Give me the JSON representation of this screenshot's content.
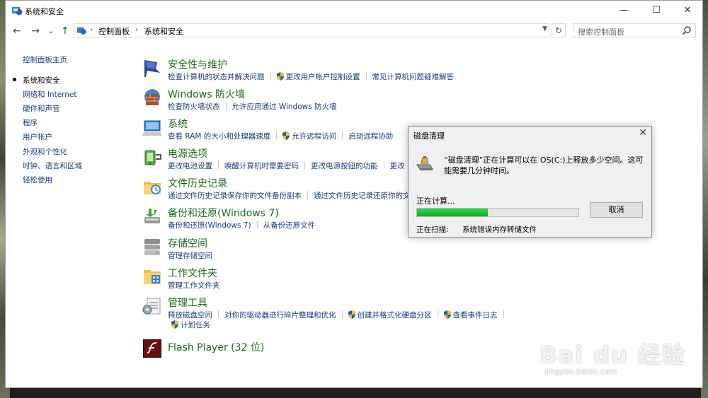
{
  "window": {
    "title": "系统和安全",
    "minimize": "—",
    "maximize": "☐",
    "close": "✕"
  },
  "nav": {
    "back": "←",
    "forward": "→",
    "recent": "⌄",
    "up": "↑",
    "breadcrumb": [
      "控制面板",
      "系统和安全"
    ],
    "refresh": "↻",
    "search_placeholder": "搜索控制面板"
  },
  "sidebar": {
    "items": [
      {
        "label": "控制面板主页"
      },
      {
        "label": "系统和安全"
      },
      {
        "label": "网络和 Internet"
      },
      {
        "label": "硬件和声音"
      },
      {
        "label": "程序"
      },
      {
        "label": "用户帐户"
      },
      {
        "label": "外观和个性化"
      },
      {
        "label": "时钟、语言和区域"
      },
      {
        "label": "轻松使用"
      }
    ]
  },
  "categories": [
    {
      "title": "安全性与维护",
      "icon": "flag-icon",
      "links": [
        {
          "label": "检查计算机的状态并解决问题",
          "shield": false
        },
        {
          "label": "更改用户帐户控制设置",
          "shield": true
        },
        {
          "label": "常见计算机问题疑难解答",
          "shield": false
        }
      ]
    },
    {
      "title": "Windows 防火墙",
      "icon": "firewall-icon",
      "links": [
        {
          "label": "检查防火墙状态",
          "shield": false
        },
        {
          "label": "允许应用通过 Windows 防火墙",
          "shield": false
        }
      ]
    },
    {
      "title": "系统",
      "icon": "computer-icon",
      "links": [
        {
          "label": "查看 RAM 的大小和处理器速度",
          "shield": false
        },
        {
          "label": "允许远程访问",
          "shield": true
        },
        {
          "label": "启动远程协助",
          "shield": false
        }
      ]
    },
    {
      "title": "电源选项",
      "icon": "power-icon",
      "links": [
        {
          "label": "更改电池设置",
          "shield": false
        },
        {
          "label": "唤醒计算机时需要密码",
          "shield": false
        },
        {
          "label": "更改电源按钮的功能",
          "shield": false
        },
        {
          "label": "更改",
          "shield": false
        }
      ]
    },
    {
      "title": "文件历史记录",
      "icon": "file-history-icon",
      "links": [
        {
          "label": "通过文件历史记录保存你的文件备份副本",
          "shield": false
        },
        {
          "label": "通过文件历史记录还原你的文",
          "shield": false
        }
      ]
    },
    {
      "title": "备份和还原(Windows 7)",
      "icon": "backup-icon",
      "links": [
        {
          "label": "备份和还原(Windows 7)",
          "shield": false
        },
        {
          "label": "从备份还原文件",
          "shield": false
        }
      ]
    },
    {
      "title": "存储空间",
      "icon": "storage-icon",
      "links": [
        {
          "label": "管理存储空间",
          "shield": false
        }
      ]
    },
    {
      "title": "工作文件夹",
      "icon": "work-folders-icon",
      "links": [
        {
          "label": "管理工作文件夹",
          "shield": false
        }
      ]
    },
    {
      "title": "管理工具",
      "icon": "admin-tools-icon",
      "links": [
        {
          "label": "释放磁盘空间",
          "shield": false
        },
        {
          "label": "对你的驱动器进行碎片整理和优化",
          "shield": false
        },
        {
          "label": "创建并格式化硬盘分区",
          "shield": true
        },
        {
          "label": "查看事件日志",
          "shield": true
        }
      ],
      "links2": [
        {
          "label": "计划任务",
          "shield": true
        }
      ]
    },
    {
      "title": "Flash Player (32 位)",
      "icon": "flash-icon",
      "links": []
    }
  ],
  "dialog": {
    "title": "磁盘清理",
    "close": "✕",
    "message": "“磁盘清理”正在计算可以在 OS(C:)上释放多少空间。这可能需要几分钟时间。",
    "status": "正在计算...",
    "progress": 0.44,
    "cancel_label": "取消",
    "scan_label": "正在扫描:",
    "scan_value": "系统错误内存转储文件"
  },
  "watermark": {
    "brand": "Bai du 经验",
    "url": "jingyan.baidu.com"
  },
  "colors": {
    "link": "#1a3c84",
    "category_title": "#1e6a1e",
    "progress": "#06b025"
  }
}
